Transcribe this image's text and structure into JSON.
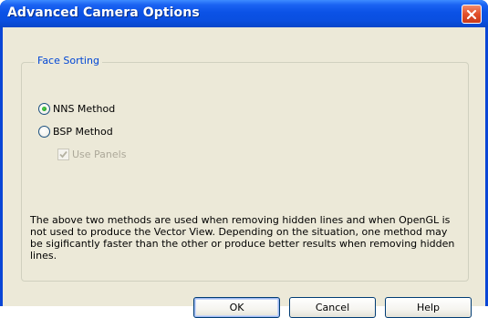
{
  "window": {
    "title": "Advanced Camera Options"
  },
  "titlebar_buttons": {
    "close_icon": "close-icon"
  },
  "face_sorting": {
    "legend": "Face Sorting",
    "options": [
      {
        "label": "NNS Method",
        "checked": true
      },
      {
        "label": "BSP Method",
        "checked": false
      }
    ],
    "use_panels": {
      "label": "Use Panels",
      "checked": true,
      "enabled": false
    }
  },
  "description": "The above two methods are used when removing hidden lines and when OpenGL is not used to produce the Vector View. Depending on the situation, one method may be sigificantly faster than the other or produce better results when removing hidden lines.",
  "buttons": {
    "ok": "OK",
    "cancel": "Cancel",
    "help": "Help"
  },
  "colors": {
    "titlebar": "#0a4fe0",
    "dialog_bg": "#ece9d8",
    "group_legend": "#0046d5",
    "close_button": "#e2502a",
    "disabled_text": "#aca899"
  }
}
